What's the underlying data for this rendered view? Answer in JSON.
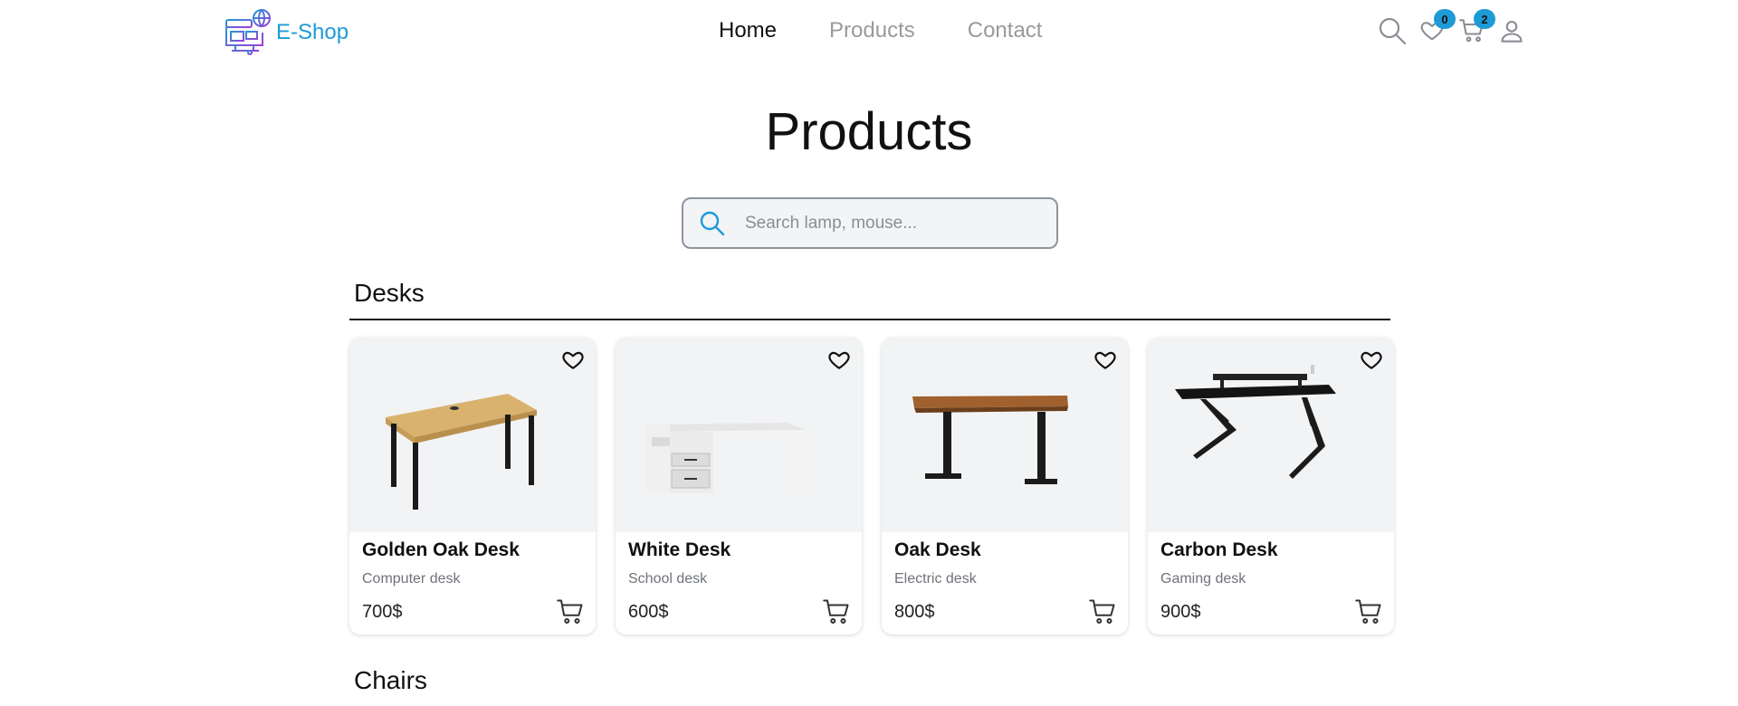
{
  "brand": {
    "name": "E-Shop",
    "accent": "#1e9bd7",
    "logo_icon": "shop-logo-icon"
  },
  "nav": {
    "items": [
      {
        "label": "Home",
        "active": true
      },
      {
        "label": "Products",
        "active": false
      },
      {
        "label": "Contact",
        "active": false
      }
    ]
  },
  "header_actions": {
    "search_icon": "search-icon",
    "wishlist_icon": "heart-icon",
    "wishlist_count": "0",
    "cart_icon": "cart-icon",
    "cart_count": "2",
    "user_icon": "user-icon"
  },
  "page": {
    "title": "Products"
  },
  "search": {
    "placeholder": "Search lamp, mouse...",
    "value": ""
  },
  "sections": [
    {
      "title": "Desks",
      "products": [
        {
          "name": "Golden Oak Desk",
          "description": "Computer desk",
          "price": "700$"
        },
        {
          "name": "White Desk",
          "description": "School desk",
          "price": "600$"
        },
        {
          "name": "Oak Desk",
          "description": "Electric desk",
          "price": "800$"
        },
        {
          "name": "Carbon Desk",
          "description": "Gaming desk",
          "price": "900$"
        }
      ]
    },
    {
      "title": "Chairs",
      "products": []
    }
  ]
}
